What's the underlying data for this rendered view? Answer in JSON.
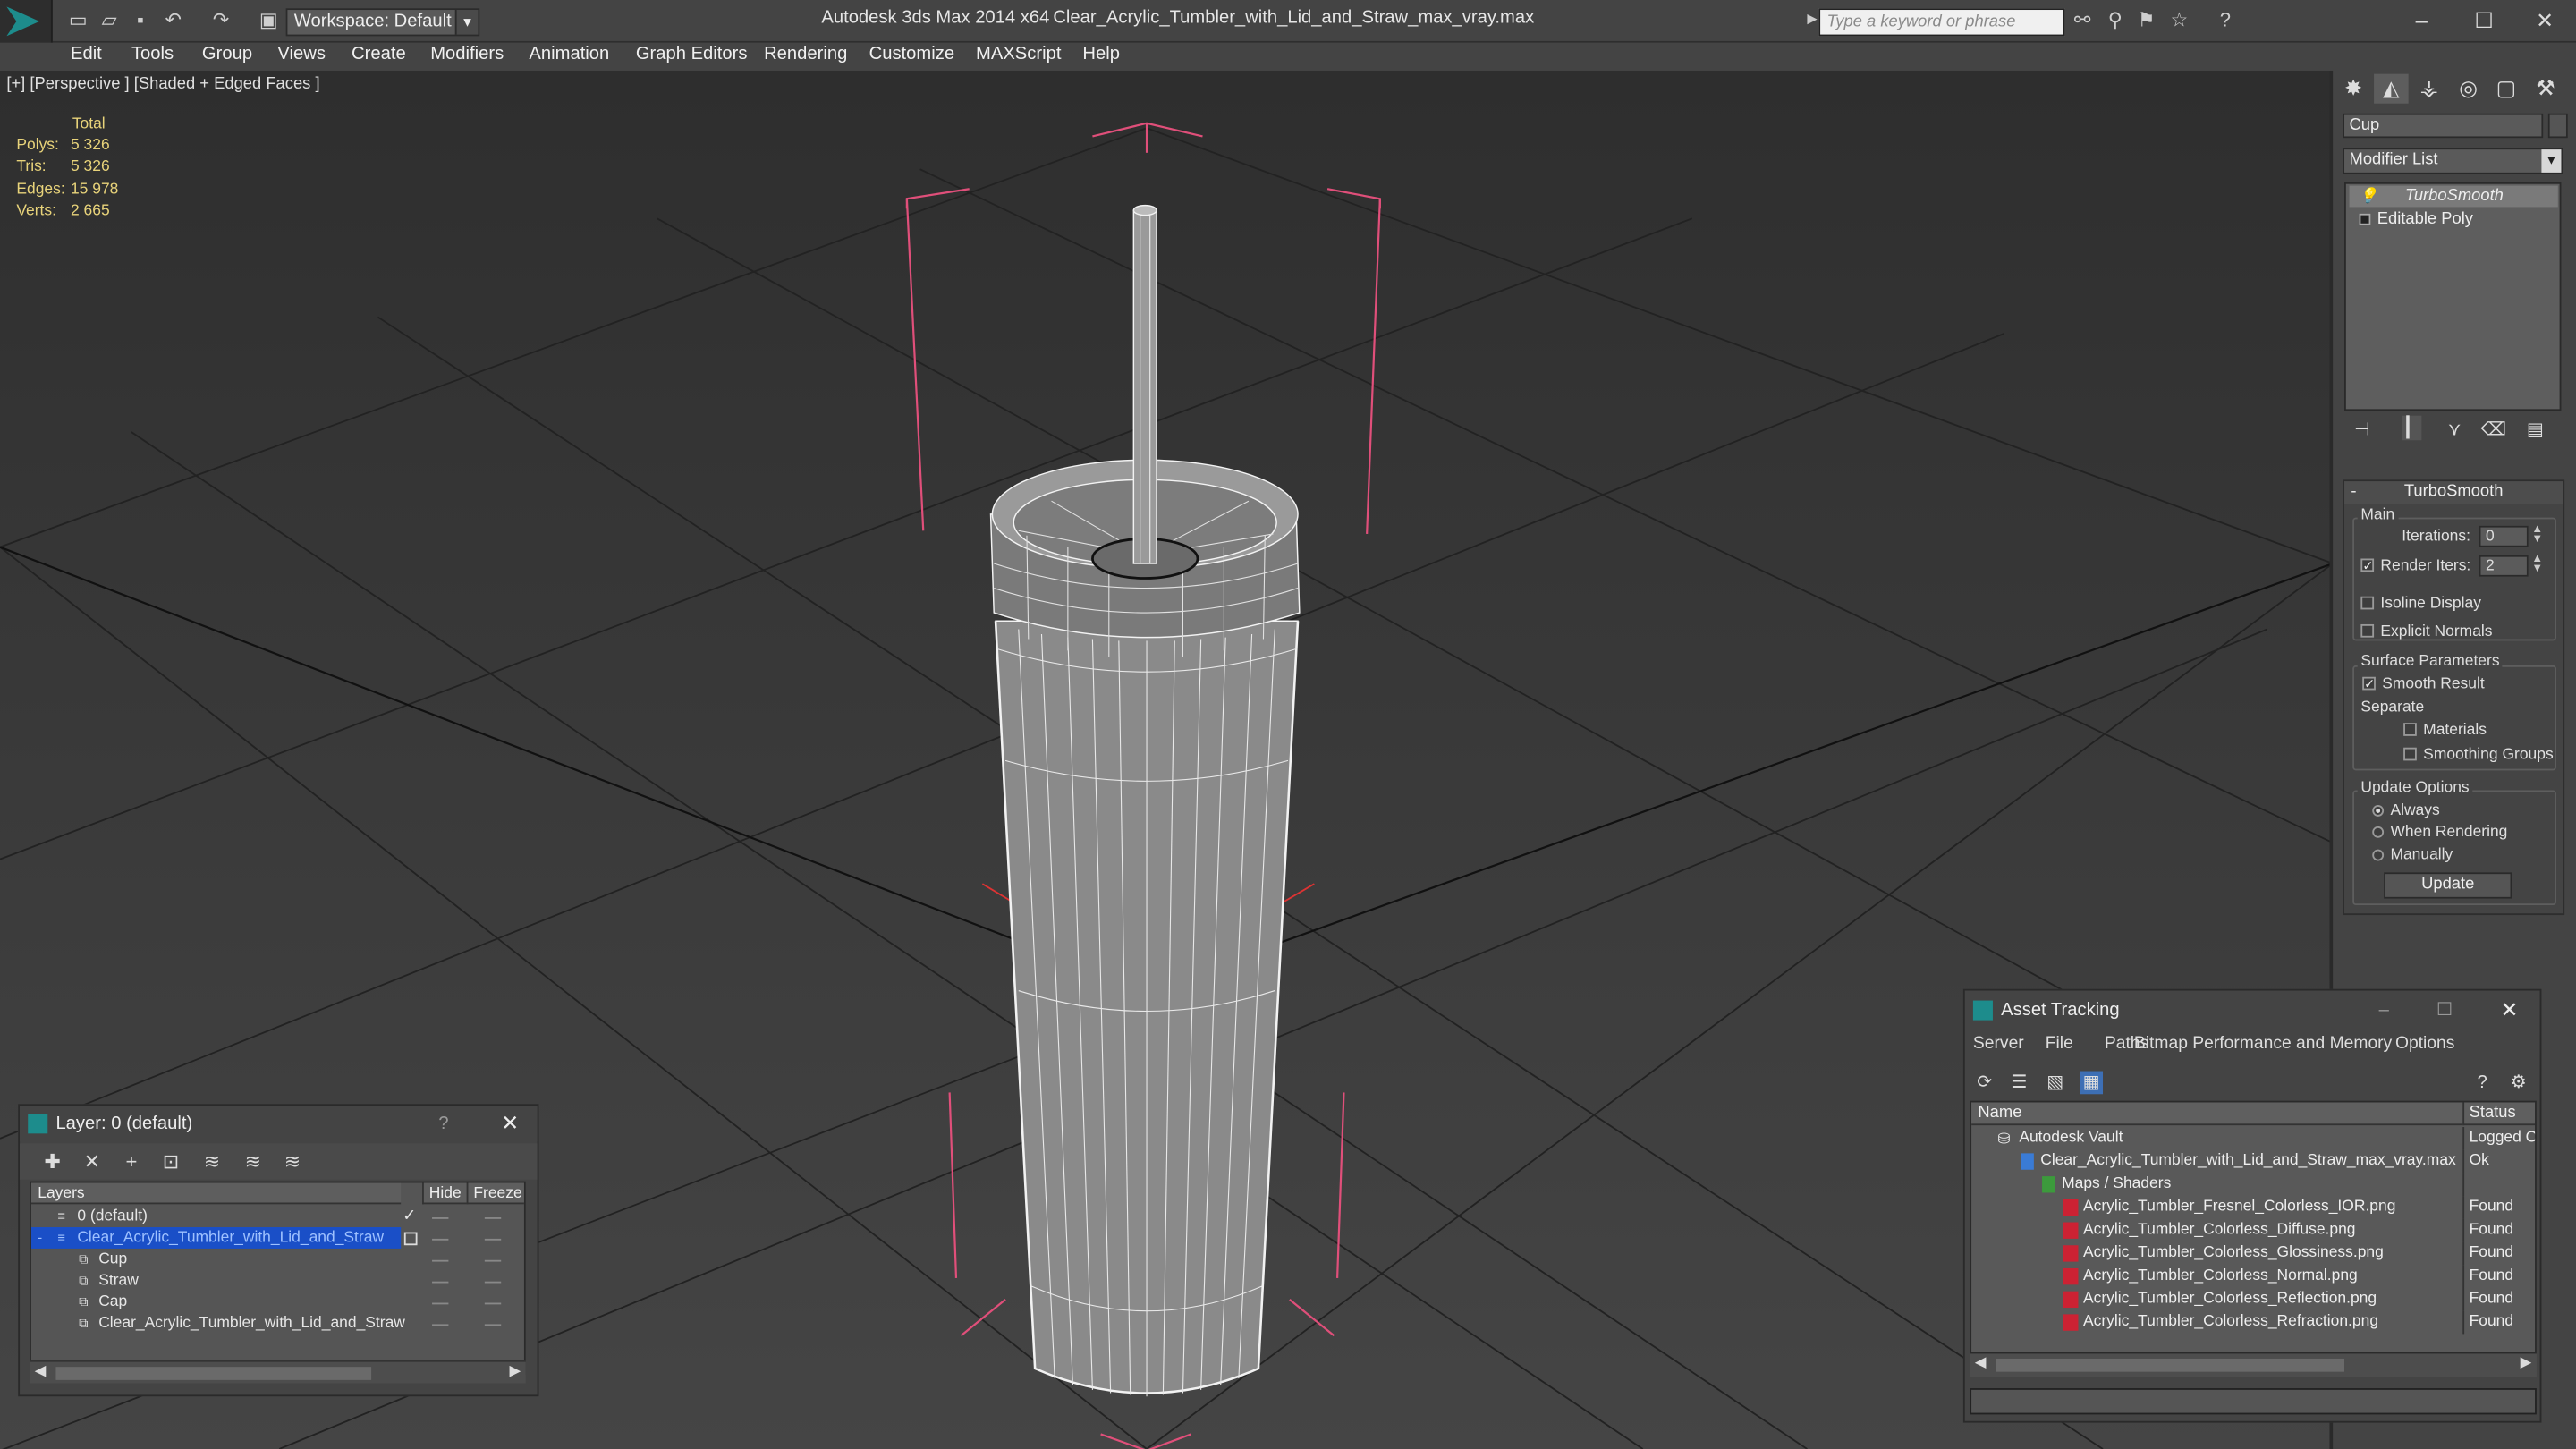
{
  "titlebar": {
    "workspace_label": "Workspace: Default",
    "app_title": "Autodesk 3ds Max  2014 x64",
    "file_title": "Clear_Acrylic_Tumbler_with_Lid_and_Straw_max_vray.max",
    "search_placeholder": "Type a keyword or phrase"
  },
  "menubar": {
    "items": [
      "Edit",
      "Tools",
      "Group",
      "Views",
      "Create",
      "Modifiers",
      "Animation",
      "Graph Editors",
      "Rendering",
      "Customize",
      "MAXScript",
      "Help"
    ]
  },
  "viewport": {
    "label": "[+] [Perspective ] [Shaded + Edged Faces ]",
    "stats": {
      "header": "Total",
      "rows": [
        {
          "label": "Polys:",
          "value": "5 326"
        },
        {
          "label": "Tris:",
          "value": "5 326"
        },
        {
          "label": "Edges:",
          "value": "15 978"
        },
        {
          "label": "Verts:",
          "value": "2 665"
        }
      ]
    }
  },
  "command_panel": {
    "object_name": "Cup",
    "modifier_list": "Modifier List",
    "stack": [
      "TurboSmooth",
      "Editable Poly"
    ],
    "turbosmooth": {
      "title": "TurboSmooth",
      "main_label": "Main",
      "iterations_label": "Iterations:",
      "iterations_value": "0",
      "render_iters_label": "Render Iters:",
      "render_iters_value": "2",
      "isoline_label": "Isoline Display",
      "explicit_normals_label": "Explicit Normals",
      "surface_label": "Surface Parameters",
      "smooth_result_label": "Smooth Result",
      "separate_label": "Separate",
      "materials_label": "Materials",
      "smoothing_groups_label": "Smoothing Groups",
      "update_options_label": "Update Options",
      "always_label": "Always",
      "when_rendering_label": "When Rendering",
      "manually_label": "Manually",
      "update_button": "Update"
    }
  },
  "layer_dialog": {
    "title": "Layer: 0 (default)",
    "help": "?",
    "col_layers": "Layers",
    "col_hide": "Hide",
    "col_freeze": "Freeze",
    "rows": [
      {
        "name": "0 (default)",
        "indent": 0
      },
      {
        "name": "Clear_Acrylic_Tumbler_with_Lid_and_Straw",
        "indent": 0
      },
      {
        "name": "Cup",
        "indent": 1
      },
      {
        "name": "Straw",
        "indent": 1
      },
      {
        "name": "Cap",
        "indent": 1
      },
      {
        "name": "Clear_Acrylic_Tumbler_with_Lid_and_Straw",
        "indent": 1
      }
    ]
  },
  "asset_dialog": {
    "title": "Asset Tracking",
    "menu": [
      "Server",
      "File",
      "Paths",
      "Bitmap Performance and Memory",
      "Options"
    ],
    "col_name": "Name",
    "col_status": "Status",
    "rows": [
      {
        "name": "Autodesk Vault",
        "status": "Logged O"
      },
      {
        "name": "Clear_Acrylic_Tumbler_with_Lid_and_Straw_max_vray.max",
        "status": "Ok"
      },
      {
        "name": "Maps / Shaders",
        "status": ""
      },
      {
        "name": "Acrylic_Tumbler_Fresnel_Colorless_IOR.png",
        "status": "Found"
      },
      {
        "name": "Acrylic_Tumbler_Colorless_Diffuse.png",
        "status": "Found"
      },
      {
        "name": "Acrylic_Tumbler_Colorless_Glossiness.png",
        "status": "Found"
      },
      {
        "name": "Acrylic_Tumbler_Colorless_Normal.png",
        "status": "Found"
      },
      {
        "name": "Acrylic_Tumbler_Colorless_Reflection.png",
        "status": "Found"
      },
      {
        "name": "Acrylic_Tumbler_Colorless_Refraction.png",
        "status": "Found"
      }
    ]
  },
  "colors": {
    "selection": "#1a4fc7",
    "stats_text": "#e8d37a",
    "bbox_pink": "#e04f7a",
    "brand_teal": "#1d8c8c"
  }
}
